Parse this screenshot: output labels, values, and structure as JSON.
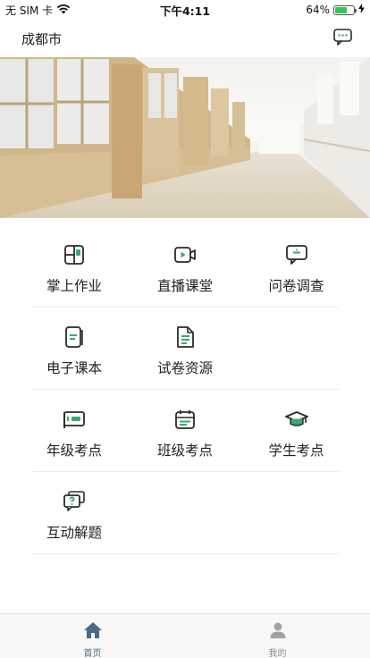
{
  "status_bar": {
    "carrier": "无 SIM 卡",
    "time": "下午4:11",
    "battery_percent": "64%",
    "battery_level": 0.64,
    "icons": [
      "wifi-icon",
      "battery-icon",
      "charging-icon"
    ]
  },
  "header": {
    "city": "成都市",
    "message_icon": "chat-bubble-icon"
  },
  "banner": {
    "image": "school-corridor-photo"
  },
  "grid": {
    "rows": [
      [
        {
          "label": "掌上作业",
          "icon": "homework-grid-icon"
        },
        {
          "label": "直播课堂",
          "icon": "live-video-icon"
        },
        {
          "label": "问卷调查",
          "icon": "survey-chat-icon"
        }
      ],
      [
        {
          "label": "电子课本",
          "icon": "ebook-icon"
        },
        {
          "label": "试卷资源",
          "icon": "exam-paper-icon"
        }
      ],
      [
        {
          "label": "年级考点",
          "icon": "grade-card-icon"
        },
        {
          "label": "班级考点",
          "icon": "class-calendar-icon"
        },
        {
          "label": "学生考点",
          "icon": "graduation-cap-icon"
        }
      ],
      [
        {
          "label": "互动解题",
          "icon": "question-chat-icon"
        }
      ]
    ]
  },
  "tab_bar": {
    "tabs": [
      {
        "label": "首页",
        "icon": "home-icon",
        "active": true
      },
      {
        "label": "我的",
        "icon": "user-icon",
        "active": false
      }
    ]
  },
  "colors": {
    "accent_green": "#3aa872",
    "icon_dark": "#2b2b2b",
    "tab_active": "#4a6a86"
  }
}
